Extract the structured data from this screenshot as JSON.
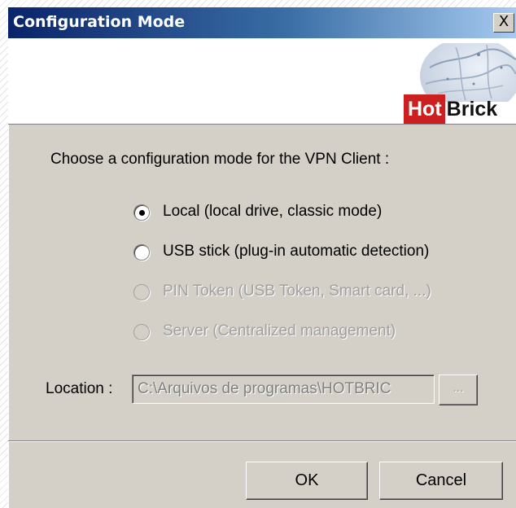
{
  "window": {
    "title": "Configuration Mode",
    "close_label": "X"
  },
  "banner": {
    "logo_part1": "Hot",
    "logo_part2": "Brick",
    "logo_accent_color": "#cc1f1f"
  },
  "prompt": "Choose a configuration mode for the VPN Client :",
  "modes": [
    {
      "label": "Local (local drive, classic mode)",
      "selected": true,
      "enabled": true
    },
    {
      "label": "USB stick (plug-in automatic detection)",
      "selected": false,
      "enabled": true
    },
    {
      "label": "PIN Token (USB Token, Smart card, ...)",
      "selected": false,
      "enabled": false
    },
    {
      "label": "Server (Centralized management)",
      "selected": false,
      "enabled": false
    }
  ],
  "location": {
    "label": "Location :",
    "value": "C:\\Arquivos de programas\\HOTBRIC",
    "browse_label": "..."
  },
  "buttons": {
    "ok": "OK",
    "cancel": "Cancel"
  },
  "colors": {
    "title_bar_start": "#0a246a",
    "title_bar_end": "#a6caf0",
    "dialog_face": "#d4d0c8"
  }
}
